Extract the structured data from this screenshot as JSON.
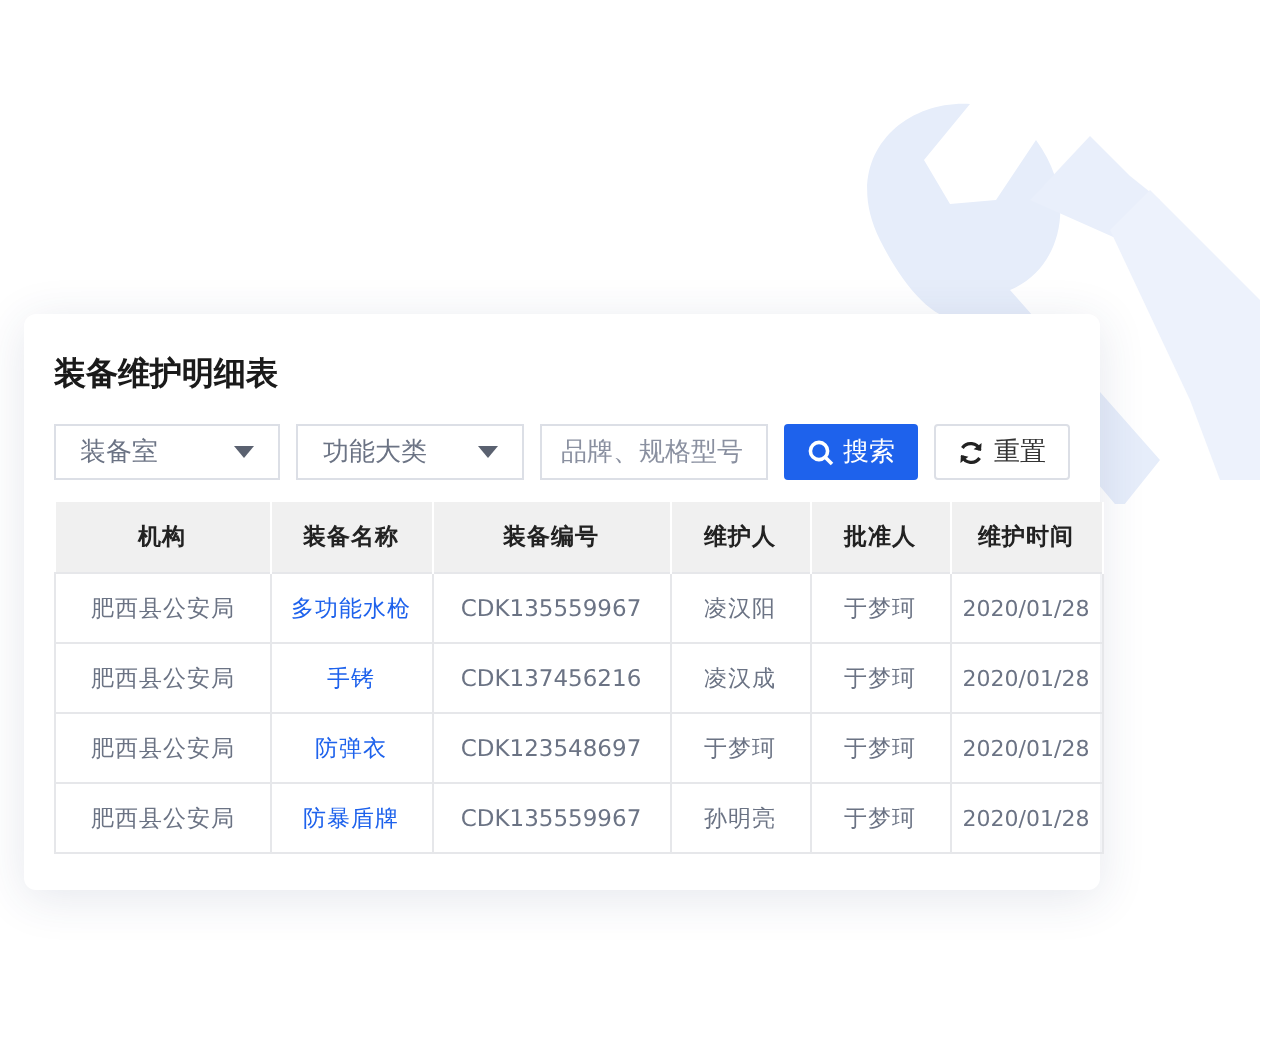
{
  "title": "装备维护明细表",
  "filters": [
    {
      "kind": "select",
      "placeholder": "装备室"
    },
    {
      "kind": "select",
      "placeholder": "功能大类"
    },
    {
      "kind": "input",
      "placeholder": "品牌、规格型号"
    }
  ],
  "buttons": [
    {
      "kind": "primary",
      "label": "搜索"
    },
    {
      "kind": "default",
      "label": "重置"
    }
  ],
  "table": {
    "columns": [
      "机构",
      "装备名称",
      "装备编号",
      "维护人",
      "批准人",
      "维护时间"
    ],
    "rows": [
      [
        "肥西县公安局",
        "多功能水枪",
        "CDK135559967",
        "凌汉阳",
        "于梦珂",
        "2020/01/28"
      ],
      [
        "肥西县公安局",
        "手铐",
        "CDK137456216",
        "凌汉成",
        "于梦珂",
        "2020/01/28"
      ],
      [
        "肥西县公安局",
        "防弹衣",
        "CDK123548697",
        "于梦珂",
        "于梦珂",
        "2020/01/28"
      ],
      [
        "肥西县公安局",
        "防暴盾牌",
        "CDK135559967",
        "孙明亮",
        "于梦珂",
        "2020/01/28"
      ]
    ]
  }
}
